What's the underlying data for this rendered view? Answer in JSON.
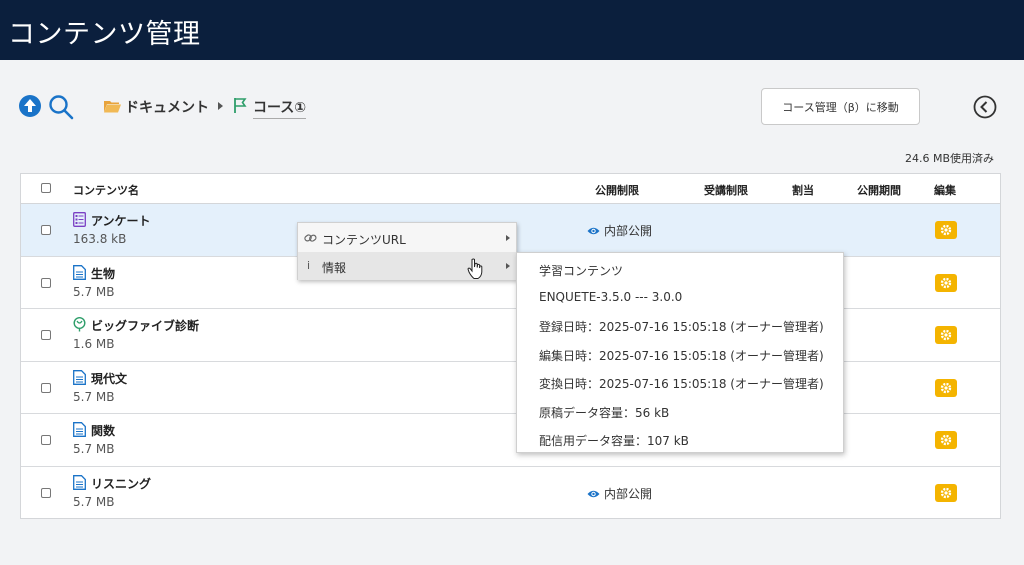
{
  "header": {
    "title": "コンテンツ管理"
  },
  "breadcrumb": {
    "root": "ドキュメント",
    "current": "コース①"
  },
  "toolbar": {
    "move_button": "コース管理（β）に移動"
  },
  "usage": "24.6 MB使用済み",
  "table": {
    "columns": [
      "コンテンツ名",
      "公開制限",
      "受講制限",
      "割当",
      "公開期間",
      "編集"
    ],
    "rows": [
      {
        "name": "アンケート",
        "size": "163.8 kB",
        "icon": "survey-icon",
        "public": "内部公開"
      },
      {
        "name": "生物",
        "size": "5.7 MB",
        "icon": "document-icon",
        "public": ""
      },
      {
        "name": "ビッグファイブ診断",
        "size": "1.6 MB",
        "icon": "diagnosis-icon",
        "public": ""
      },
      {
        "name": "現代文",
        "size": "5.7 MB",
        "icon": "document-icon",
        "public": ""
      },
      {
        "name": "関数",
        "size": "5.7 MB",
        "icon": "document-icon",
        "public": ""
      },
      {
        "name": "リスニング",
        "size": "5.7 MB",
        "icon": "document-icon",
        "public": "内部公開"
      }
    ]
  },
  "context_menu": {
    "items": [
      {
        "label": "コンテンツURL",
        "icon": "link-icon"
      },
      {
        "label": "情報",
        "icon": "info-icon"
      }
    ]
  },
  "info_panel": {
    "lines": [
      "学習コンテンツ",
      "ENQUETE-3.5.0 --- 3.0.0",
      "登録日時：2025-07-16 15:05:18 (オーナー管理者)",
      "編集日時：2025-07-16 15:05:18 (オーナー管理者)",
      "変換日時：2025-07-16 15:05:18 (オーナー管理者)",
      "原稿データ容量：56 kB",
      "配信用データ容量：107 kB"
    ]
  },
  "colors": {
    "header_bg": "#0b1f3d",
    "accent_blue": "#1a73c8",
    "edit_orange": "#f4b400",
    "row_highlight": "#e4f0fb"
  }
}
